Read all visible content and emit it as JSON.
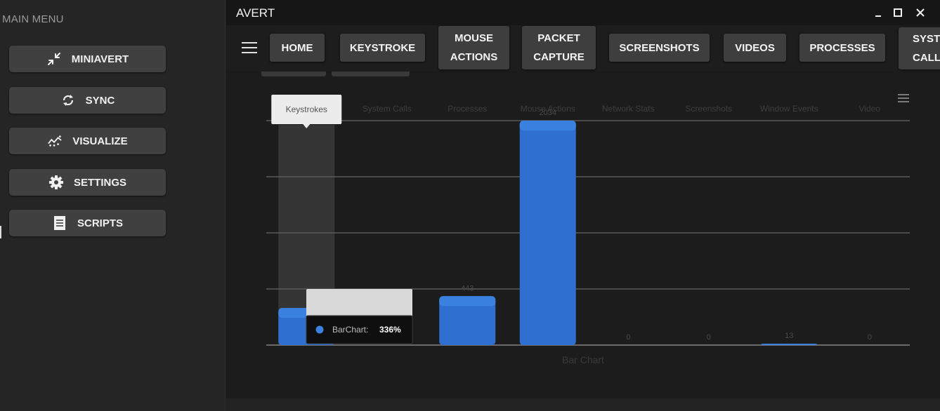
{
  "sidebar": {
    "title": "MAIN MENU",
    "items": [
      {
        "label": "MINIAVERT",
        "icon": "shrink-arrows-icon"
      },
      {
        "label": "SYNC",
        "icon": "sync-icon"
      },
      {
        "label": "VISUALIZE",
        "icon": "chart-trend-icon"
      },
      {
        "label": "SETTINGS",
        "icon": "gear-icon"
      },
      {
        "label": "SCRIPTS",
        "icon": "document-icon"
      }
    ]
  },
  "window": {
    "title": "AVERT",
    "controls": [
      "minimize-icon",
      "maximize-icon",
      "close-icon"
    ]
  },
  "nav": {
    "menu_icon": "hamburger-icon",
    "tabs": [
      {
        "line1": "HOME",
        "line2": ""
      },
      {
        "line1": "KEYSTROKE",
        "line2": ""
      },
      {
        "line1": "MOUSE",
        "line2": "ACTIONS"
      },
      {
        "line1": "PACKET",
        "line2": "CAPTURE"
      },
      {
        "line1": "SCREENSHOTS",
        "line2": ""
      },
      {
        "line1": "VIDEOS",
        "line2": ""
      },
      {
        "line1": "PROCESSES",
        "line2": ""
      },
      {
        "line1": "SYSTI",
        "line2": "CALL"
      }
    ]
  },
  "chart_data": {
    "type": "bar",
    "title": "",
    "xlabel": "Bar Chart",
    "ylabel": "",
    "categories": [
      "Keystrokes",
      "System Calls",
      "Processes",
      "Mouse Actions",
      "Network Stats",
      "Screenshots",
      "Window Events",
      "Video"
    ],
    "series": [
      {
        "name": "BarChart",
        "values": [
          336,
          0,
          443,
          2034,
          0,
          0,
          13,
          0
        ]
      }
    ],
    "data_labels": [
      "",
      "",
      "443",
      "2034",
      "0",
      "0",
      "13",
      "0"
    ],
    "ylim": [
      0,
      2034
    ],
    "grid": true,
    "legend": "none",
    "hovered_category": "Keystrokes",
    "tooltip": {
      "header": "Keystrokes",
      "series_label": "BarChart:",
      "value": "336%"
    },
    "menu_icon": "chart-menu-icon",
    "colors": {
      "bar": "#2f6fd0",
      "bar_top": "#3b82e0",
      "hover_column": "#3a3a3a",
      "grid": "#5a5a5a"
    }
  }
}
